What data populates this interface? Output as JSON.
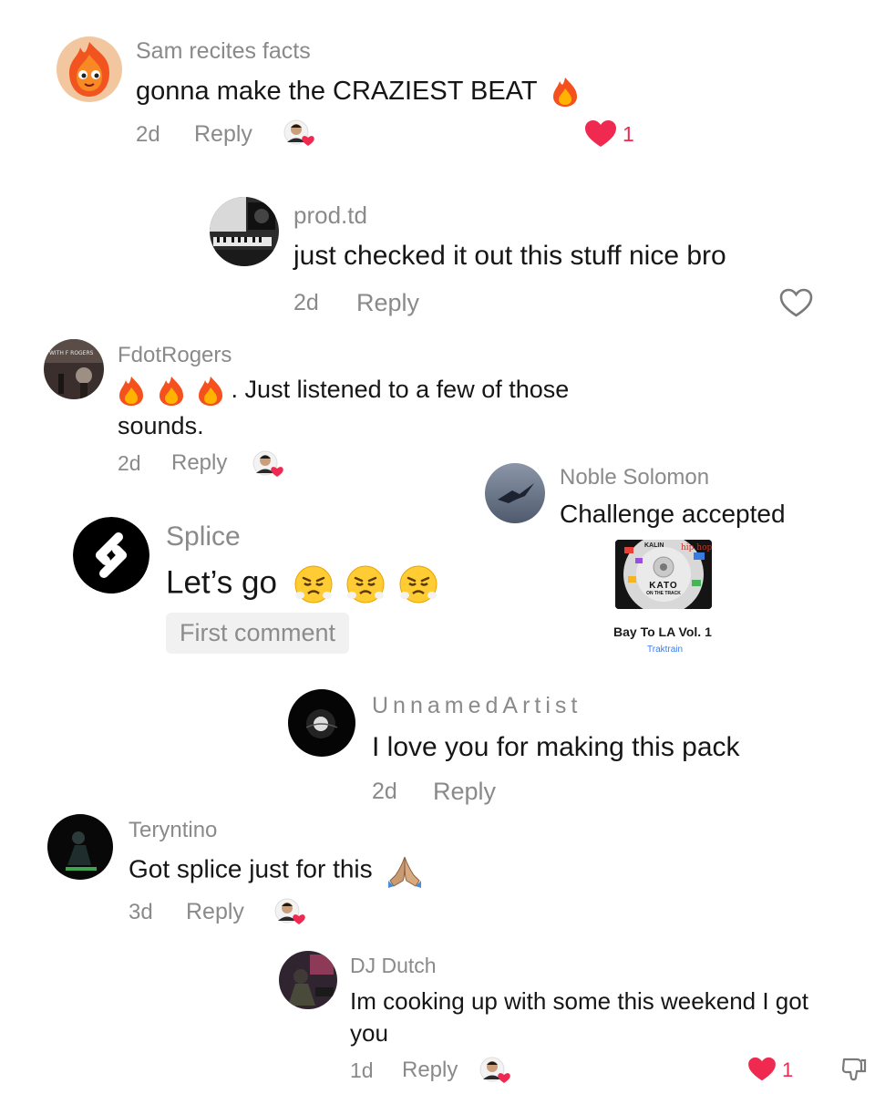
{
  "comments": [
    {
      "user": "Sam recites facts",
      "text": "gonna make the CRAZIEST BEAT",
      "age": "2d",
      "reply": "Reply",
      "likes": "1"
    },
    {
      "user": "prod.td",
      "text": "just checked it out this stuff nice bro",
      "age": "2d",
      "reply": "Reply"
    },
    {
      "user": "FdotRogers",
      "text_line1": ". Just listened to a few of those",
      "text_line2": "sounds.",
      "age": "2d",
      "reply": "Reply",
      "avatar_caption": "WITH F ROGERS"
    },
    {
      "user": "Noble Solomon",
      "text": "Challenge accepted"
    },
    {
      "user": "Splice",
      "text": "Let’s go",
      "badge": "First comment"
    },
    {
      "user": "UnnamedArtist",
      "text": "I love you for making this pack",
      "age": "2d",
      "reply": "Reply"
    },
    {
      "user": "Teryntino",
      "text": "Got splice just for this",
      "age": "3d",
      "reply": "Reply"
    },
    {
      "user": "DJ Dutch",
      "text_line1": "Im cooking up with some this weekend I got",
      "text_line2": "you",
      "age": "1d",
      "reply": "Reply",
      "likes": "1"
    }
  ],
  "album": {
    "title": "Bay To LA Vol. 1",
    "subtitle": "Traktrain",
    "cover_text": "KATO",
    "cover_sub": "ON THE TRACK",
    "cover_sticker": "hip hop",
    "cover_label": "KALIN"
  },
  "colors": {
    "like_red": "#ef2950",
    "muted_gray": "#8a8a8a",
    "text_dark": "#161616"
  },
  "icons": [
    "fire-icon",
    "heart-filled-icon",
    "heart-outline-icon",
    "creator-liked-icon",
    "huffing-face-icon",
    "folded-hands-icon",
    "dislike-icon"
  ]
}
